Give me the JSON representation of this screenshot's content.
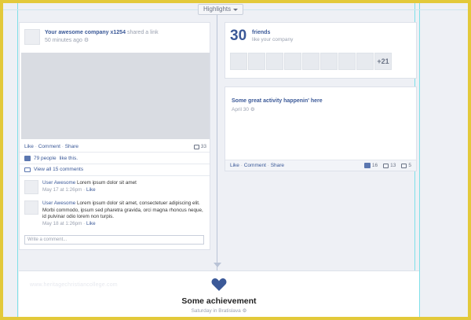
{
  "toolbar": {
    "highlights_label": "Highlights"
  },
  "post": {
    "author": "Your awesome company x1254",
    "action": "shared a link",
    "time": "50 minutes ago",
    "actions": {
      "like": "Like",
      "comment": "Comment",
      "share": "Share",
      "sep": " · "
    },
    "comment_count": "33",
    "likes_text": "79 people",
    "likes_suffix": "like this.",
    "view_all": "View all 15 comments",
    "comments": [
      {
        "author": "User Awesome",
        "text": "Lorem ipsum dolor sit amet",
        "time": "May 17 at 1:26pm",
        "like": "Like"
      },
      {
        "author": "User Awesome",
        "text": "Lorem ipsum dolor sit amet, consectetuer adipiscing elit. Morbi commodo, ipsum sed pharetra gravida, orci magna rhoncus neque, id pulvinar odio lorem non turpis.",
        "time": "May 18 at 1:26pm",
        "like": "Like"
      }
    ],
    "write_placeholder": "Write a comment..."
  },
  "friends": {
    "count": "30",
    "label": "friends",
    "sub": "like your company",
    "more": "+21"
  },
  "activity": {
    "title": "Some great activity happenin' here",
    "time": "April 30",
    "actions": {
      "like": "Like",
      "comment": "Comment",
      "share": "Share",
      "sep": " · "
    },
    "stats": {
      "likes": "16",
      "comments": "13",
      "shares": "5"
    }
  },
  "achievement": {
    "title": "Some achievement",
    "sub": "Saturday in Bratislava"
  },
  "watermark": "www.heritagechristiancollege.com",
  "colors": {
    "accent": "#3b5998",
    "heart": "#3b5998",
    "frame": "#e3c93a"
  }
}
